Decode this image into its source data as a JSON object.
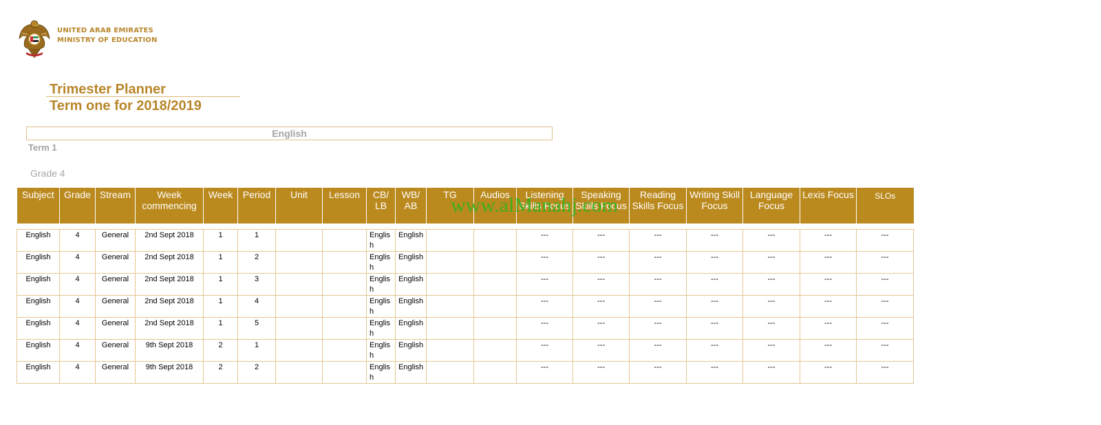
{
  "header": {
    "ministry_line1": "UNITED ARAB EMIRATES",
    "ministry_line2": "MINISTRY OF EDUCATION",
    "logo": "uae-falcon-emblem"
  },
  "title": "Trimester Planner",
  "subtitle": "Term one for 2018/2019",
  "subject_box": "English",
  "term_label": "Term 1",
  "grade_label": "Grade 4",
  "watermark": "www.alManahj.com",
  "colors": {
    "gold": "#bb8a1f",
    "header_text": "#ffffff",
    "border": "#e6c592",
    "watermark": "#2bb51c"
  },
  "table": {
    "headers": [
      "Subject",
      "Grade",
      "Stream",
      "Week commencing",
      "Week",
      "Period",
      "Unit",
      "Lesson",
      "CB/ LB",
      "WB/ AB",
      "TG",
      "Audios",
      "Listening Skills Focus",
      "Speaking Skills Focus",
      "Reading Skills Focus",
      "Writing Skill Focus",
      "Language Focus",
      "Lexis Focus",
      "SLOs"
    ],
    "rows": [
      [
        "English",
        "4",
        "General",
        "2nd Sept 2018",
        "1",
        "1",
        "",
        "",
        "English",
        "English",
        "",
        "",
        "---",
        "---",
        "---",
        "---",
        "---",
        "---",
        "---"
      ],
      [
        "English",
        "4",
        "General",
        "2nd Sept 2018",
        "1",
        "2",
        "",
        "",
        "English",
        "English",
        "",
        "",
        "---",
        "---",
        "---",
        "---",
        "---",
        "---",
        "---"
      ],
      [
        "English",
        "4",
        "General",
        "2nd Sept 2018",
        "1",
        "3",
        "",
        "",
        "English",
        "English",
        "",
        "",
        "---",
        "---",
        "---",
        "---",
        "---",
        "---",
        "---"
      ],
      [
        "English",
        "4",
        "General",
        "2nd Sept 2018",
        "1",
        "4",
        "",
        "",
        "English",
        "English",
        "",
        "",
        "---",
        "---",
        "---",
        "---",
        "---",
        "---",
        "---"
      ],
      [
        "English",
        "4",
        "General",
        "2nd Sept 2018",
        "1",
        "5",
        "",
        "",
        "English",
        "English",
        "",
        "",
        "---",
        "---",
        "---",
        "---",
        "---",
        "---",
        "---"
      ],
      [
        "English",
        "4",
        "General",
        "9th Sept 2018",
        "2",
        "1",
        "",
        "",
        "English",
        "English",
        "",
        "",
        "---",
        "---",
        "---",
        "---",
        "---",
        "---",
        "---"
      ],
      [
        "English",
        "4",
        "General",
        "9th Sept 2018",
        "2",
        "2",
        "",
        "",
        "English",
        "English",
        "",
        "",
        "---",
        "---",
        "---",
        "---",
        "---",
        "---",
        "---"
      ]
    ]
  }
}
